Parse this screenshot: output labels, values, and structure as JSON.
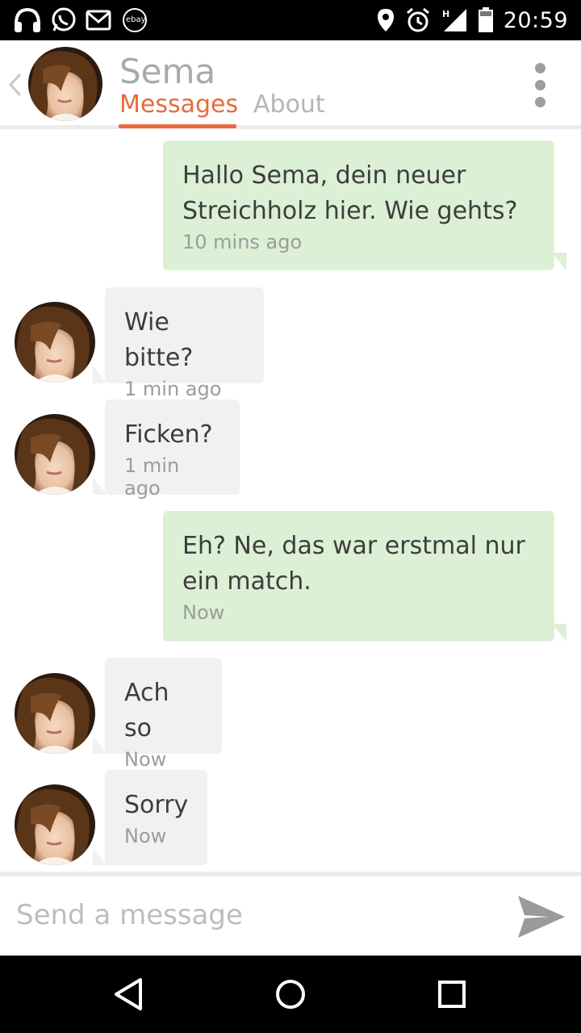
{
  "status_bar": {
    "time": "20:59",
    "left_icons": [
      "headphones-icon",
      "whatsapp-icon",
      "gmail-icon",
      "ebay-kleinanzeigen-icon"
    ],
    "right_icons": [
      "location-icon",
      "alarm-icon",
      "signal-h-icon",
      "battery-icon"
    ],
    "network_label": "H"
  },
  "header": {
    "title": "Sema",
    "tabs": [
      {
        "label": "Messages",
        "active": true
      },
      {
        "label": "About",
        "active": false
      }
    ],
    "accent_color": "#e66a3c"
  },
  "messages": [
    {
      "direction": "sent",
      "text": "Hallo Sema, dein neuer Streichholz hier. Wie gehts?",
      "time": "10 mins ago"
    },
    {
      "direction": "received",
      "text": "Wie bitte?",
      "time": "1 min ago"
    },
    {
      "direction": "received",
      "text": "Ficken?",
      "time": "1 min ago"
    },
    {
      "direction": "sent",
      "text": "Eh? Ne, das war erstmal nur ein match.",
      "time": "Now"
    },
    {
      "direction": "received",
      "text": "Ach so",
      "time": "Now"
    },
    {
      "direction": "received",
      "text": "Sorry",
      "time": "Now"
    }
  ],
  "composer": {
    "placeholder": "Send a message"
  },
  "nav_bar": [
    "back-icon",
    "home-icon",
    "recents-icon"
  ],
  "colors": {
    "sent_bubble": "#dcf0d5",
    "received_bubble": "#f1f1f1"
  }
}
